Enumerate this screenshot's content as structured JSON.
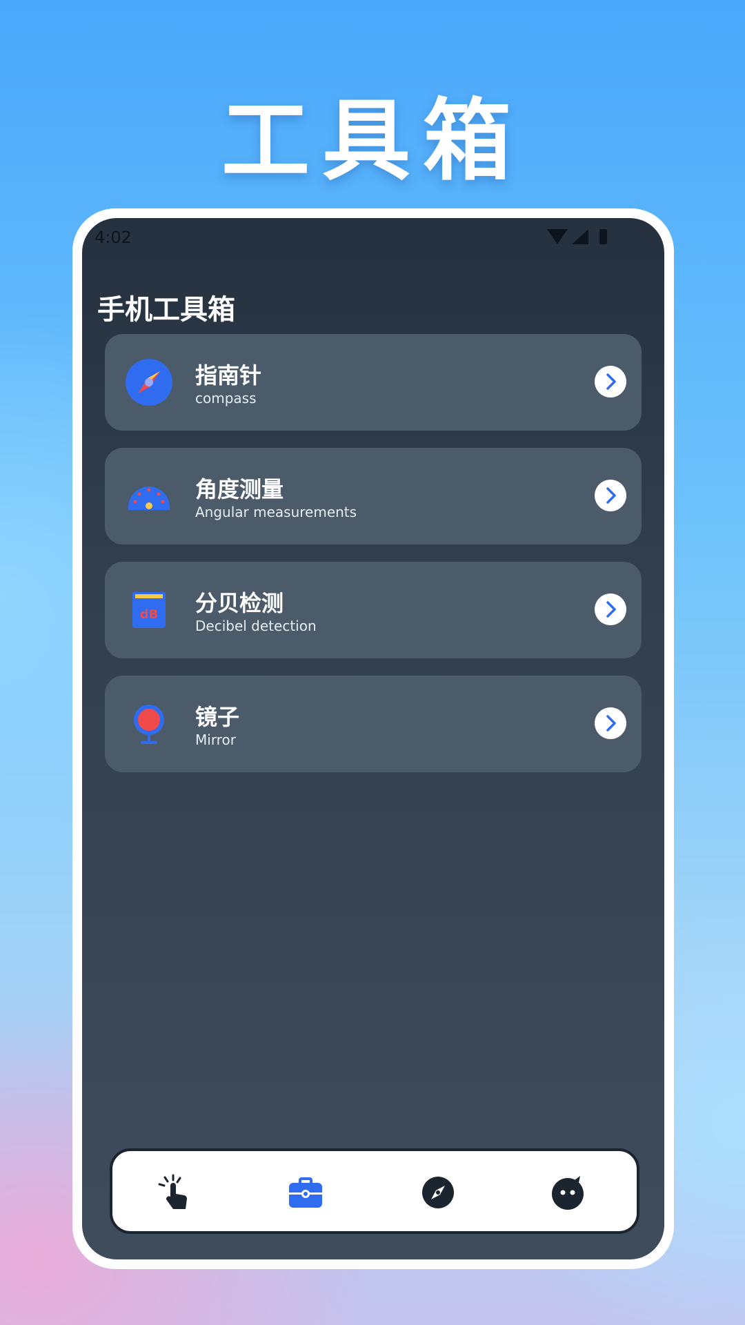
{
  "hero": {
    "title": "工具箱"
  },
  "status_bar": {
    "time": "4:02"
  },
  "app": {
    "title": "手机工具箱"
  },
  "tools": [
    {
      "name": "指南针",
      "subtitle": "compass",
      "icon": "compass-icon"
    },
    {
      "name": "角度测量",
      "subtitle": "Angular measurements",
      "icon": "gauge-icon"
    },
    {
      "name": "分贝检测",
      "subtitle": "Decibel detection",
      "icon": "decibel-meter-icon"
    },
    {
      "name": "镜子",
      "subtitle": "Mirror",
      "icon": "mirror-icon"
    }
  ],
  "bottom_nav": [
    {
      "icon": "tap-gesture-icon",
      "active": false
    },
    {
      "icon": "toolbox-icon",
      "active": true
    },
    {
      "icon": "compass-icon",
      "active": false
    },
    {
      "icon": "character-face-icon",
      "active": false
    }
  ],
  "colors": {
    "accent": "#2f6cf0",
    "card": "#4b5b6a",
    "screen": "#2a3644"
  }
}
